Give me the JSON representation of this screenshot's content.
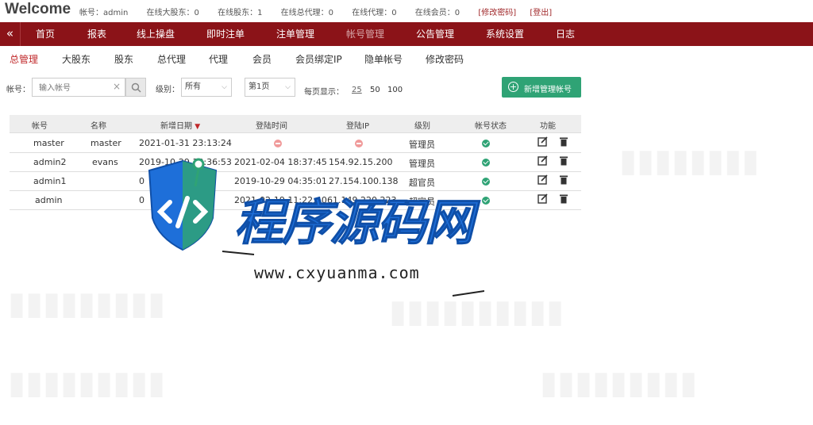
{
  "header": {
    "welcome": "Welcome",
    "account": "帐号：admin",
    "online_major": "在线大股东：0",
    "online_shareholder": "在线股东：1",
    "online_general_agent": "在线总代理：0",
    "online_agent": "在线代理：0",
    "online_member": "在线会员：0",
    "change_password": "[修改密码]",
    "logout": "[登出]"
  },
  "nav": {
    "toggle": "«",
    "items": [
      "首页",
      "报表",
      "线上操盘",
      "即时注单",
      "注单管理",
      "帐号管理",
      "公告管理",
      "系统设置",
      "日志"
    ],
    "active_index": 5
  },
  "subnav": {
    "items": [
      "总管理",
      "大股东",
      "股东",
      "总代理",
      "代理",
      "会员",
      "会员绑定IP",
      "隐单帐号",
      "修改密码"
    ],
    "active_index": 0
  },
  "filter": {
    "account_label": "帐号：",
    "account_placeholder": "输入帐号",
    "clear_icon": "×",
    "level_label": "级别：",
    "level_value": "所有",
    "page_value": "第1页",
    "per_page_label": "每页显示：",
    "per_page_options": [
      "25",
      "50",
      "100"
    ],
    "per_page_selected": "25",
    "add_button": "新增管理帐号"
  },
  "table": {
    "headers": [
      "帐号",
      "名称",
      "新增日期",
      "登陆时间",
      "登陆IP",
      "级别",
      "帐号状态",
      "功能"
    ],
    "sort_arrow": "▼",
    "rows": [
      {
        "account": "master",
        "name": "master",
        "created": "2021-01-31 23:13:24",
        "login_time": "",
        "login_ip": "",
        "level": "管理员",
        "login_time_status": "none",
        "status": "active"
      },
      {
        "account": "admin2",
        "name": "evans",
        "created": "2019-10-29 18:36:53",
        "login_time": "2021-02-04 18:37:45",
        "login_ip": "154.92.15.200",
        "level": "管理员",
        "login_time_status": "ok",
        "status": "active"
      },
      {
        "account": "admin1",
        "name": "",
        "created": "0",
        "login_time": "2019-10-29 04:35:01",
        "login_ip": "27.154.100.138",
        "level": "超官员",
        "login_time_status": "ok",
        "status": "active"
      },
      {
        "account": "admin",
        "name": "",
        "created": "0",
        "login_time": "2021-02-19 11:22:40",
        "login_ip": "61.149.220.223",
        "level": "超官员",
        "login_time_status": "ok",
        "status": "active"
      }
    ]
  },
  "watermark": {
    "title": "程序源码网",
    "url": "www.cxyuanma.com"
  },
  "colors": {
    "nav_bg": "#8b1318",
    "accent_red": "#c0282a",
    "button_green": "#2fa375",
    "watermark_blue": "#1e6fd9"
  }
}
